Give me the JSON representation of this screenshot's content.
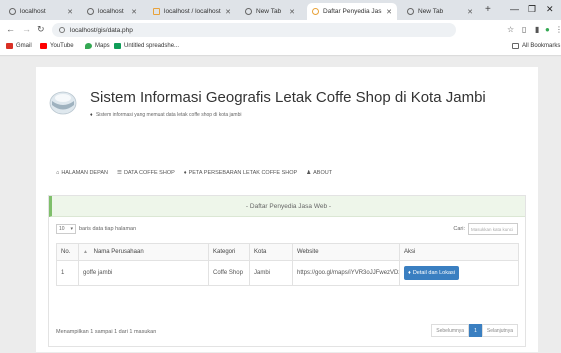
{
  "browser": {
    "tabs": [
      {
        "label": "localhost",
        "active": false
      },
      {
        "label": "localhost",
        "active": false
      },
      {
        "label": "localhost / localhost /",
        "active": false
      },
      {
        "label": "New Tab",
        "active": false
      },
      {
        "label": "Daftar Penyedia Jas",
        "active": true
      },
      {
        "label": "New Tab",
        "active": false
      }
    ],
    "new_tab_label": "+",
    "url": "localhost/gis/data.php",
    "bookmarks": [
      {
        "label": "Gmail",
        "color": "#d93025"
      },
      {
        "label": "YouTube",
        "color": "#ff0000"
      },
      {
        "label": "Maps",
        "color": "#34a853"
      },
      {
        "label": "Untitled spreadshe...",
        "color": "#0f9d58"
      }
    ],
    "all_bookmarks_label": "All Bookmarks"
  },
  "site": {
    "title": "Sistem Informasi Geografis Letak Coffe Shop di Kota Jambi",
    "subtitle": "Sistem informasi yang memuat data letak coffe shop di kota jambi",
    "menu": [
      {
        "label": "HALAMAN DEPAN",
        "icon": "home-icon"
      },
      {
        "label": "DATA COFFE SHOP",
        "icon": "list-icon"
      },
      {
        "label": "PETA PERSEBARAN LETAK COFFE SHOP",
        "icon": "map-marker-icon"
      },
      {
        "label": "ABOUT",
        "icon": "user-icon"
      }
    ]
  },
  "panel": {
    "heading": "- Daftar Penyedia Jasa Web -",
    "length_value": "10",
    "length_suffix": "baris data tiap halaman",
    "search_label": "Cari:",
    "search_placeholder": "Masukkan kata kunci",
    "columns": [
      "No.",
      "Nama Perusahaan",
      "Kategori",
      "Kota",
      "Website",
      "Aksi"
    ],
    "rows": [
      {
        "no": "1",
        "nama": "goffe jambi",
        "kategori": "Coffe Shop",
        "kota": "Jambi",
        "website": "https://goo.gl/maps/iYVR3oJJFwezVDzr9",
        "aksi": "Detail dan Lokasi"
      }
    ],
    "info": "Menampilkan 1 sampai 1 dari 1 masukan",
    "pager": {
      "prev": "Sebelumnya",
      "current": "1",
      "next": "Selanjutnya"
    }
  },
  "colors": {
    "accent": "#3a7fc1",
    "panel_head": "#eef6ea",
    "panel_border": "#7fbf6b"
  }
}
